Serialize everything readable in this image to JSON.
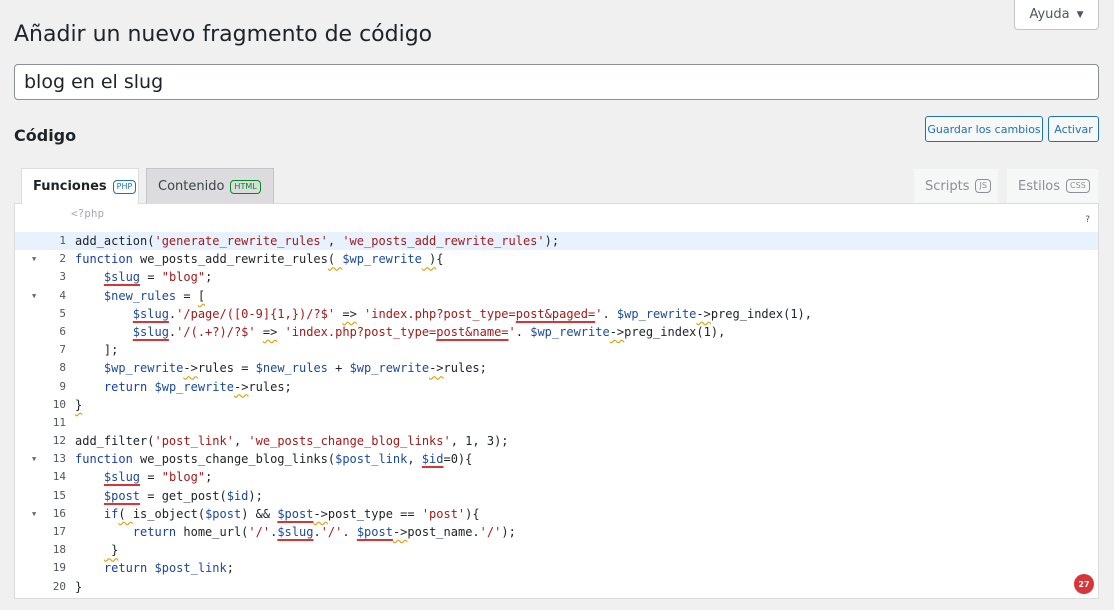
{
  "help": {
    "label": "Ayuda",
    "caret": "▼"
  },
  "page": {
    "title": "Añadir un nuevo fragmento de código"
  },
  "snippet": {
    "title_value": "blog en el slug"
  },
  "code_section": {
    "heading": "Código"
  },
  "buttons": {
    "save": "Guardar los cambios",
    "activate": "Activar"
  },
  "tabs": [
    {
      "label": "Funciones",
      "badge": "PHP",
      "active": true
    },
    {
      "label": "Contenido",
      "badge": "HTML",
      "active": false
    },
    {
      "label": "Scripts",
      "badge": "JS",
      "active": false
    },
    {
      "label": "Estilos",
      "badge": "CSS",
      "active": false
    }
  ],
  "editor": {
    "php_open": "<?php",
    "help_q": "?",
    "issue_count": "27",
    "lines": [
      {
        "n": "1",
        "fold": false,
        "active": true,
        "html": "add_action(<span class='str'>'generate_rewrite_rules'</span>, <span class='str'>'we_posts_add_rewrite_rules'</span>);"
      },
      {
        "n": "2",
        "fold": true,
        "active": false,
        "html": "<span class='kw'>function</span> we_posts_add_rewrite_rules<span class='warn'>( </span><span class='var'>$wp_rewrite</span><span class='warn'> )</span>{"
      },
      {
        "n": "3",
        "fold": false,
        "active": false,
        "html": "    <span class='var err'>$slug</span> = <span class='str'>\"blog\"</span>;"
      },
      {
        "n": "4",
        "fold": true,
        "active": false,
        "html": "    <span class='var'>$new_rules</span> = <span class='warn'>[</span>"
      },
      {
        "n": "5",
        "fold": false,
        "active": false,
        "html": "        <span class='var err'>$slug</span>.<span class='str'>'/page/([0-9]{1,})/?$'</span> <span class='warn'>=></span> <span class='str'>'index.php?post_type=<span class='err'>post&amp;paged=</span>'</span>. <span class='var'>$wp_rewrite</span><span class='warn'>-></span>preg_index(1),"
      },
      {
        "n": "6",
        "fold": false,
        "active": false,
        "html": "        <span class='var err'>$slug</span>.<span class='str'>'/(.+?)/?$'</span> <span class='warn'>=></span> <span class='str'>'index.php?post_type=<span class='err'>post&amp;name=</span>'</span>. <span class='var'>$wp_rewrite</span><span class='warn'>-></span>preg_index(1),"
      },
      {
        "n": "7",
        "fold": false,
        "active": false,
        "html": "    ];"
      },
      {
        "n": "8",
        "fold": false,
        "active": false,
        "html": "    <span class='var'>$wp_rewrite</span><span class='warn'>-></span>rules = <span class='var'>$new_rules</span> + <span class='var'>$wp_rewrite</span><span class='warn'>-></span>rules;"
      },
      {
        "n": "9",
        "fold": false,
        "active": false,
        "html": "    <span class='kw'>return</span> <span class='var'>$wp_rewrite</span><span class='warn'>-></span>rules;"
      },
      {
        "n": "10",
        "fold": false,
        "active": false,
        "html": "<span class='warn'>}</span>"
      },
      {
        "n": "11",
        "fold": false,
        "active": false,
        "html": ""
      },
      {
        "n": "12",
        "fold": false,
        "active": false,
        "html": "add_filter(<span class='str'>'post_link'</span>, <span class='str'>'we_posts_change_blog_links'</span>, 1, 3);"
      },
      {
        "n": "13",
        "fold": true,
        "active": false,
        "html": "<span class='kw'>function</span> we_posts_change_blog_links(<span class='var'>$post_link</span>, <span class='var err'>$id</span>=0){"
      },
      {
        "n": "14",
        "fold": false,
        "active": false,
        "html": "    <span class='var err'>$slug</span> = <span class='str'>\"blog\"</span>;"
      },
      {
        "n": "15",
        "fold": false,
        "active": false,
        "html": "    <span class='var err'>$post</span> = get_post(<span class='var'>$id</span>);"
      },
      {
        "n": "16",
        "fold": true,
        "active": false,
        "html": "    <span class='kw'>if</span><span class='warn'>( </span>is_object(<span class='var'>$post</span>) &amp;&amp; <span class='var err'>$post</span><span class='warn'>-></span>post_type == <span class='str'>'post'</span>){"
      },
      {
        "n": "17",
        "fold": false,
        "active": false,
        "html": "        <span class='kw'>return</span> home_url(<span class='str'>'/'</span>.<span class='var err'>$slug</span>.<span class='str'>'/'</span>. <span class='var err'>$post</span><span class='warn'>-></span>post_name.<span class='str'>'/'</span>);"
      },
      {
        "n": "18",
        "fold": false,
        "active": false,
        "html": "    <span class='warn'> }</span>"
      },
      {
        "n": "19",
        "fold": false,
        "active": false,
        "html": "    <span class='kw'>return</span> <span class='var'>$post_link</span>;"
      },
      {
        "n": "20",
        "fold": false,
        "active": false,
        "html": "}"
      }
    ]
  }
}
